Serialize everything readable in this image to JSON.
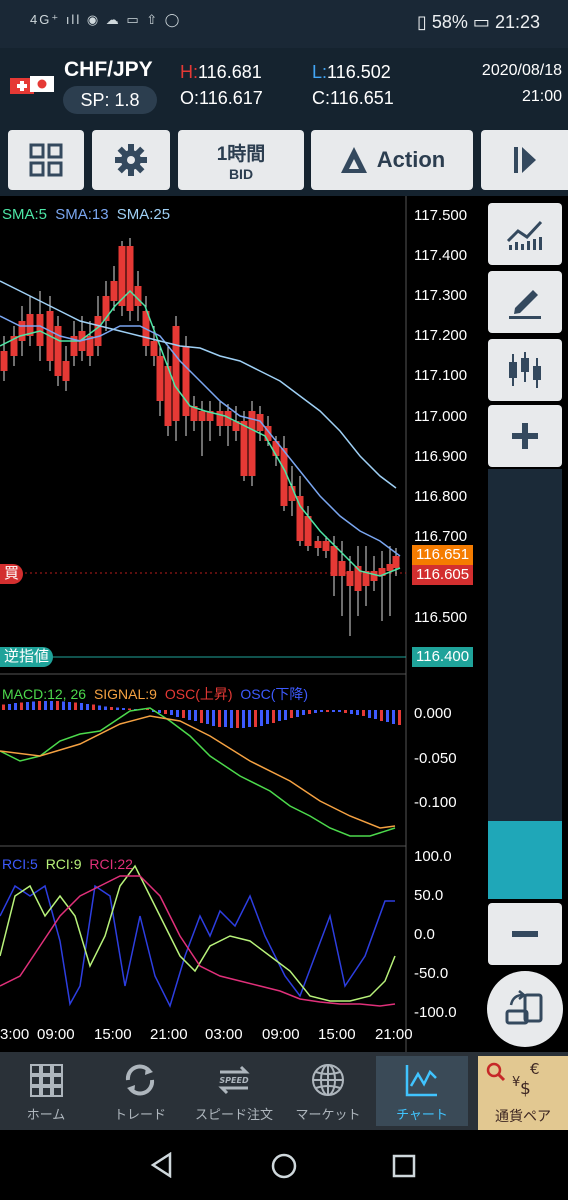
{
  "status_bar": {
    "left_icons": "4G⁺ ıll ◉ ☁ ▭ ⇧ ◯",
    "battery": "58%",
    "time": "21:23"
  },
  "header": {
    "pair": "CHF/JPY",
    "spread": "SP: 1.8",
    "high_label": "H:",
    "high": "116.681",
    "low_label": "L:",
    "low": "116.502",
    "open_label": "O:",
    "open": "116.617",
    "close_label": "C:",
    "close": "116.651",
    "date": "2020/08/18",
    "time": "21:00"
  },
  "toolbar": {
    "timeframe": "1時間",
    "price_type": "BID",
    "action": "Action"
  },
  "chart": {
    "sma_labels": {
      "sma5": "SMA:5",
      "sma13": "SMA:13",
      "sma25": "SMA:25"
    },
    "price_ticks": [
      "117.500",
      "117.400",
      "117.300",
      "117.200",
      "117.100",
      "117.000",
      "116.900",
      "116.800",
      "116.700",
      "116.500"
    ],
    "tag_current": "116.651",
    "tag_buy": "116.605",
    "buy_label": "買",
    "stop_label": "逆指値",
    "stop_price": "116.400",
    "macd_labels": {
      "macd": "MACD:12, 26",
      "signal": "SIGNAL:9",
      "osc_up": "OSC(上昇)",
      "osc_down": "OSC(下降)"
    },
    "macd_ticks": [
      "0.000",
      "-0.050",
      "-0.100"
    ],
    "rci_labels": {
      "rci5": "RCI:5",
      "rci9": "RCI:9",
      "rci22": "RCI:22"
    },
    "rci_ticks": [
      "100.0",
      "50.0",
      "0.0",
      "-50.0",
      "-100.0"
    ],
    "time_ticks": [
      "3:00",
      "09:00",
      "15:00",
      "21:00",
      "03:00",
      "09:00",
      "15:00",
      "21:00"
    ],
    "colors": {
      "bull": "#1fa7d8",
      "bear": "#e53935",
      "sma5": "#4de6a6",
      "sma13": "#7aa6f0",
      "sma25": "#9fd0f5",
      "macd": "#4cd94c",
      "signal": "#f4a142",
      "rci5": "#2d3ee0",
      "rci9": "#b8f27a",
      "rci22": "#e0307a"
    }
  },
  "nav": {
    "home": "ホーム",
    "trade": "トレード",
    "speed": "スピード注文",
    "market": "マーケット",
    "chart": "チャート",
    "currency": "通貨ペア"
  }
}
